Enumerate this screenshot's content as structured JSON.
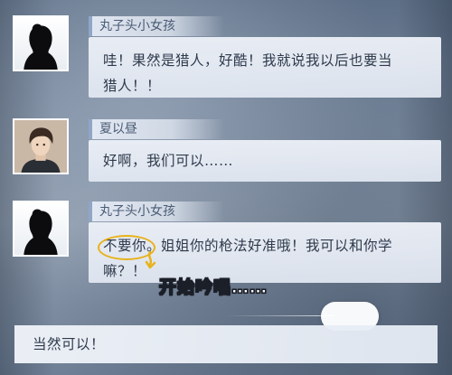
{
  "messages": [
    {
      "sender": "丸子头小女孩",
      "avatar": "girl-silhouette-icon",
      "line1": "哇！果然是猎人，好酷！我就说我以后也要当",
      "line2": "猎人！！"
    },
    {
      "sender": "夏以昼",
      "avatar": "young-man-portrait-icon",
      "line1": "好啊，我们可以……"
    },
    {
      "sender": "丸子头小女孩",
      "avatar": "girl-silhouette-icon",
      "highlight": "不要你",
      "line1_rest": "。姐姐你的枪法好准哦！我可以和你学",
      "line2": "嘛？！"
    }
  ],
  "caption": "开始吟唱……",
  "reply": "当然可以！",
  "colors": {
    "highlight_ring": "#e8b21b",
    "name_tag_accent": "#8fa6c7",
    "caption_text": "#ffffff"
  }
}
